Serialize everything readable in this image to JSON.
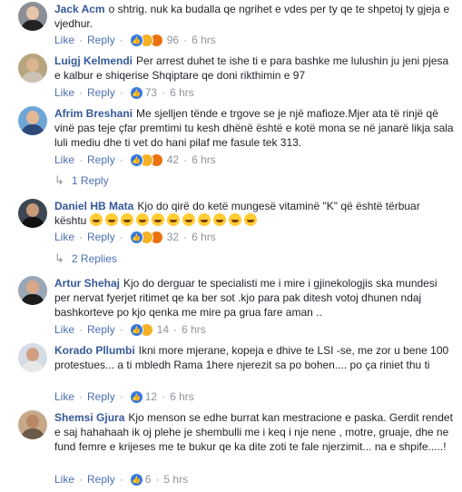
{
  "labels": {
    "like": "Like",
    "reply": "Reply",
    "dot": "·"
  },
  "comments": [
    {
      "author": "Jack Acm",
      "text": "o shtrig. nuk ka budalla qe ngrihet e vdes per ty qe te shpetoj ty gjeja e vjedhur.",
      "reactions": [
        "like-icon",
        "haha-icon",
        "angry-icon"
      ],
      "count": "96",
      "time": "6 hrs"
    },
    {
      "author": "Luigj Kelmendi",
      "text": "Per arrest duhet te ishe ti e para bashke me lulushin ju jeni pjesa e kalbur e shiqerise Shqiptare qe doni rikthimin e 97",
      "reactions": [
        "like-icon"
      ],
      "count": "73",
      "time": "6 hrs"
    },
    {
      "author": "Afrim Breshani",
      "text": "Me sjelljen tënde e trgove se je një mafioze.Mjer ata të rinjë që vinë pas teje çfar premtimi tu kesh dhënë është e kotë mona se në janarë likja sala luli mediu dhe ti vet do hani pilaf me fasule tek 313.",
      "reactions": [
        "like-icon",
        "haha-icon",
        "angry-icon"
      ],
      "count": "42",
      "time": "6 hrs",
      "replies_label": "1 Reply"
    },
    {
      "author": "Daniel HB Mata",
      "text": "Kjo do qirë do ketë mungesë vitaminë \"K\" që është tërbuar kështu",
      "emoji_count": 11,
      "reactions": [
        "like-icon",
        "haha-icon",
        "angry-icon"
      ],
      "count": "32",
      "time": "6 hrs",
      "replies_label": "2 Replies"
    },
    {
      "author": "Artur Shehaj",
      "text": "Kjo do derguar te specialisti me i mire i gjinekologjis ska mundesi per nervat fyerjet ritimet qe ka ber sot .kjo para pak ditesh votoj dhunen ndaj bashkorteve po kjo qenka me mire pa grua fare aman ..",
      "reactions": [
        "like-icon",
        "haha-icon"
      ],
      "count": "14",
      "time": "6 hrs"
    },
    {
      "author": "Korado Pllumbi",
      "text": "Ikni more mjerane, kopeja e dhive te LSI -se, me zor u bene 100 protestues... a ti mbledh Rama 1here njerezit sa po bohen.... po ça riniet thu ti",
      "reactions": [
        "like-icon"
      ],
      "count": "12",
      "time": "6 hrs"
    },
    {
      "author": "Shemsi Gjura",
      "text": "Kjo menson se edhe burrat kan mestracione e paska. Gerdit rendet e saj hahahaah ik oj plehe je shembulli me i keq i nje nene , motre, gruaje, dhe ne fund femre e krijeses me te bukur qe ka dite zoti te fale njerzimit... na e shpife.....!",
      "reactions": [
        "like-icon"
      ],
      "count": "6",
      "time": "5 hrs"
    }
  ]
}
